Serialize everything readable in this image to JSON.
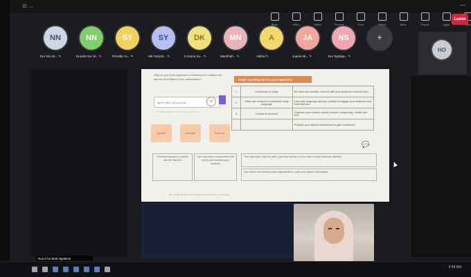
{
  "topbar": {
    "left_text": "⊙ ...",
    "right_text": "—"
  },
  "toolbar": {
    "items": [
      {
        "label": "Mute"
      },
      {
        "label": "Video"
      },
      {
        "label": "Share"
      },
      {
        "label": "Record"
      },
      {
        "label": "Chat"
      },
      {
        "label": "React"
      },
      {
        "label": "More"
      },
      {
        "label": "People"
      },
      {
        "label": "Apps"
      },
      {
        "label": "View"
      }
    ],
    "leave_label": "Leave"
  },
  "participants": [
    {
      "initials": "NN",
      "name": "Nur Nis Ab... ✎",
      "color": "#cfd6e4",
      "text": "#3b4a6b"
    },
    {
      "initials": "NN",
      "name": "Nuralis Nur Hi... ✎",
      "color": "#7fcf6a",
      "text": "#ffffff"
    },
    {
      "initials": "SY",
      "name": "Priscilla Yu... ✎",
      "color": "#f2d15e",
      "text": "#ffffff"
    },
    {
      "initials": "SY",
      "name": "Siti Yazirah... ✎",
      "color": "#b5bff0",
      "text": "#3c4a9b"
    },
    {
      "initials": "DK",
      "name": "D Kuma Su... ✎",
      "color": "#f0e17a",
      "text": "#8a7a1d"
    },
    {
      "initials": "MN",
      "name": "Mardhiah... ✎",
      "color": "#e8b3b9",
      "text": "#ffffff"
    },
    {
      "initials": "A",
      "name": "Alisha ✎",
      "color": "#f0d66b",
      "text": "#9a7c15"
    },
    {
      "initials": "JA",
      "name": "Juanis Ab... ✎",
      "color": "#f2a79a",
      "text": "#ffffff"
    },
    {
      "initials": "NS",
      "name": "Nur Syafiqa... ✎",
      "color": "#f1a7b2",
      "text": "#ffffff"
    },
    {
      "initials": "+",
      "name": "",
      "color": "#3b3d43",
      "text": "#bdbdbd"
    }
  ],
  "self_tile": {
    "initials": "HO"
  },
  "slide": {
    "question": "Why do you think someone is interested to continue the speech and listen to your presentation?",
    "heading": "Public speaking tips for good speeches",
    "answer_placeholder": "type it here, as soon as...",
    "circle_label": "↺",
    "faint_text": "The best speech is one that connects",
    "table": [
      {
        "n": "1",
        "topic": "Connection & clarity",
        "desc": "Be clear and concise; connect with your audience from the start"
      },
      {
        "n": "2",
        "topic": "Make eye contact & comfortable body language",
        "desc": "Use body language and eye contact to engage your audience and hold attention"
      },
      {
        "n": "3",
        "topic": "Content & structure",
        "desc": "Organize your content clearly; include a beginning, middle and end"
      },
      {
        "n": "",
        "topic": "",
        "desc": "Practice your speech beforehand to gain confidence"
      }
    ],
    "flow_boxes": [
      "Speaker",
      "Message",
      "Audience"
    ],
    "bottom_left": "Emotional appeal to connect with the listeners",
    "bottom_mid": "Give conclusion to summarise the points and motivate your audience",
    "bottom_right_1": "Tone and voice: vary the pitch, pace and volume of your voice to keep audience attentive",
    "bottom_right_2": "Use stories and humour where appropriate to make your speech memorable",
    "footer": "Be confident and don't forget to smile when you speak"
  },
  "speaker_name": "Nurul Ain Binti Ngatimin",
  "clock": "9:48 AM"
}
